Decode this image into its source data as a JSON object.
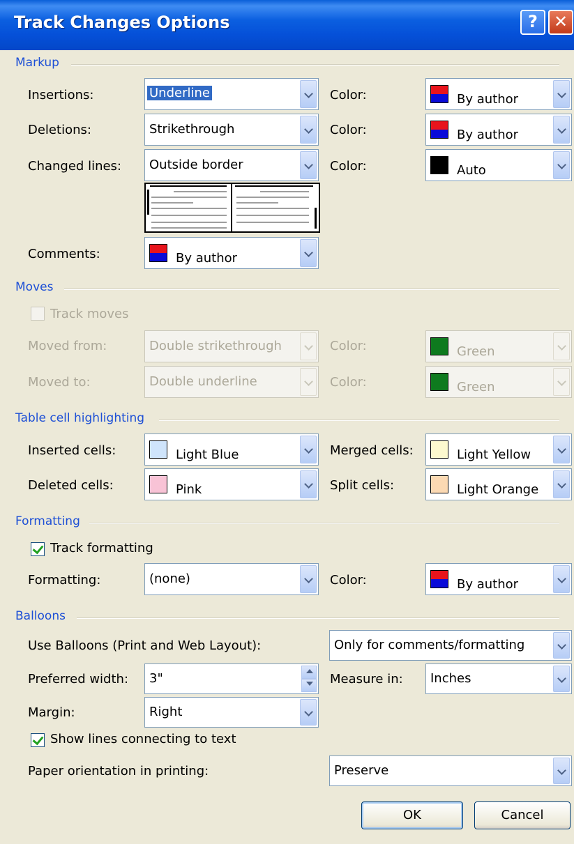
{
  "window": {
    "title": "Track Changes Options"
  },
  "sections": {
    "markup": "Markup",
    "moves": "Moves",
    "table": "Table cell highlighting",
    "formatting": "Formatting",
    "balloons": "Balloons"
  },
  "markup": {
    "insertions_label": "Insertions:",
    "insertions_value": "Underline",
    "deletions_label": "Deletions:",
    "deletions_value": "Strikethrough",
    "changed_lines_label": "Changed lines:",
    "changed_lines_value": "Outside border",
    "comments_label": "Comments:",
    "comments_value": "By author",
    "color_label": "Color:",
    "insertions_color": "By author",
    "deletions_color": "By author",
    "changed_lines_color": "Auto"
  },
  "moves": {
    "track_moves_label": "Track moves",
    "moved_from_label": "Moved from:",
    "moved_from_value": "Double strikethrough",
    "moved_to_label": "Moved to:",
    "moved_to_value": "Double underline",
    "color_label": "Color:",
    "moved_from_color": "Green",
    "moved_to_color": "Green"
  },
  "table": {
    "inserted_label": "Inserted cells:",
    "inserted_value": "Light Blue",
    "deleted_label": "Deleted cells:",
    "deleted_value": "Pink",
    "merged_label": "Merged cells:",
    "merged_value": "Light Yellow",
    "split_label": "Split cells:",
    "split_value": "Light Orange"
  },
  "formatting": {
    "track_label": "Track formatting",
    "formatting_label": "Formatting:",
    "formatting_value": "(none)",
    "color_label": "Color:",
    "color_value": "By author"
  },
  "balloons": {
    "use_label": "Use Balloons (Print and Web Layout):",
    "use_value": "Only for comments/formatting",
    "width_label": "Preferred width:",
    "width_value": "3\"",
    "measure_label": "Measure in:",
    "measure_value": "Inches",
    "margin_label": "Margin:",
    "margin_value": "Right",
    "show_lines_label": "Show lines connecting to text",
    "paper_label": "Paper orientation in printing:",
    "paper_value": "Preserve"
  },
  "buttons": {
    "ok": "OK",
    "cancel": "Cancel"
  },
  "colors": {
    "by_author_top": "#e8141c",
    "by_author_bottom": "#0a0bd8",
    "auto": "#000000",
    "green": "#0e7a1e",
    "light_blue": "#cfe4fb",
    "pink": "#f8c3d6",
    "light_yellow": "#fdf9cf",
    "light_orange": "#fbd9b3"
  }
}
